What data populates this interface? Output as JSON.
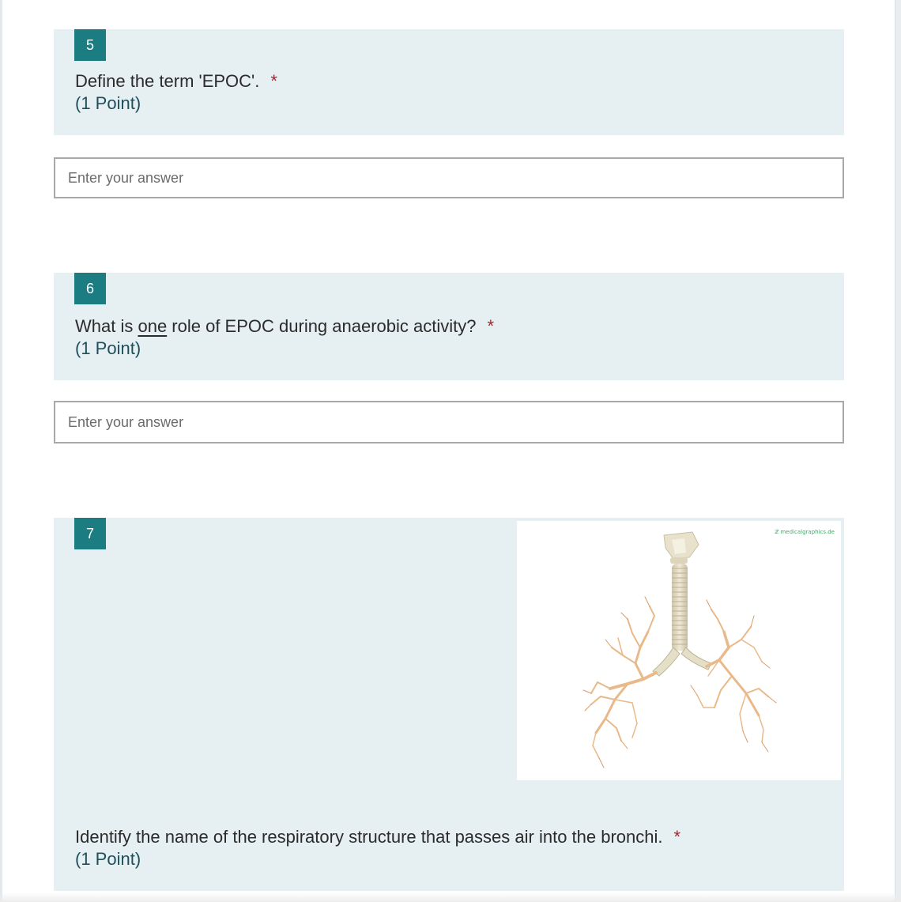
{
  "questions": [
    {
      "number": "5",
      "text": "Define the term 'EPOC'.",
      "required_marker": "*",
      "points": "(1 Point)",
      "answer_placeholder": "Enter your answer"
    },
    {
      "number": "6",
      "text_before": "What is ",
      "text_underlined": "one",
      "text_after": " role of EPOC during anaerobic activity?",
      "required_marker": "*",
      "points": "(1 Point)",
      "answer_placeholder": "Enter your answer"
    },
    {
      "number": "7",
      "image_watermark": "medicalgraphics.de",
      "image_subject": "trachea-and-bronchi-illustration",
      "text": "Identify the name of the respiratory structure that passes air into the bronchi.",
      "required_marker": "*",
      "points": "(1 Point)"
    }
  ],
  "colors": {
    "question_background": "#e6eff2",
    "number_badge": "#1b7c81",
    "required_marker": "#a4262c",
    "points_text": "#1e4f5b",
    "answer_border": "#a8a8a8"
  }
}
